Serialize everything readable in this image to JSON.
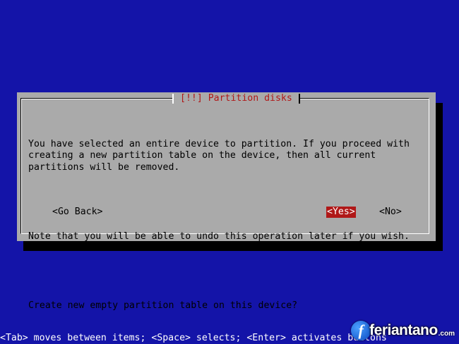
{
  "dialog": {
    "title": "[!!] Partition disks",
    "paragraphs": [
      "You have selected an entire device to partition. If you proceed with\ncreating a new partition table on the device, then all current\npartitions will be removed.",
      "Note that you will be able to undo this operation later if you wish.",
      "Create new empty partition table on this device?"
    ],
    "buttons": {
      "go_back": "<Go Back>",
      "yes": "<Yes>",
      "no": "<No>"
    },
    "selected_button": "yes"
  },
  "status_line": "<Tab> moves between items; <Space> selects; <Enter> activates buttons",
  "watermark": {
    "logo_letter": "f",
    "text": "feriantano",
    "suffix": ".com"
  },
  "colors": {
    "background": "#1414a8",
    "dialog": "#aaaaaa",
    "accent": "#b01818",
    "shadow": "#000000"
  }
}
